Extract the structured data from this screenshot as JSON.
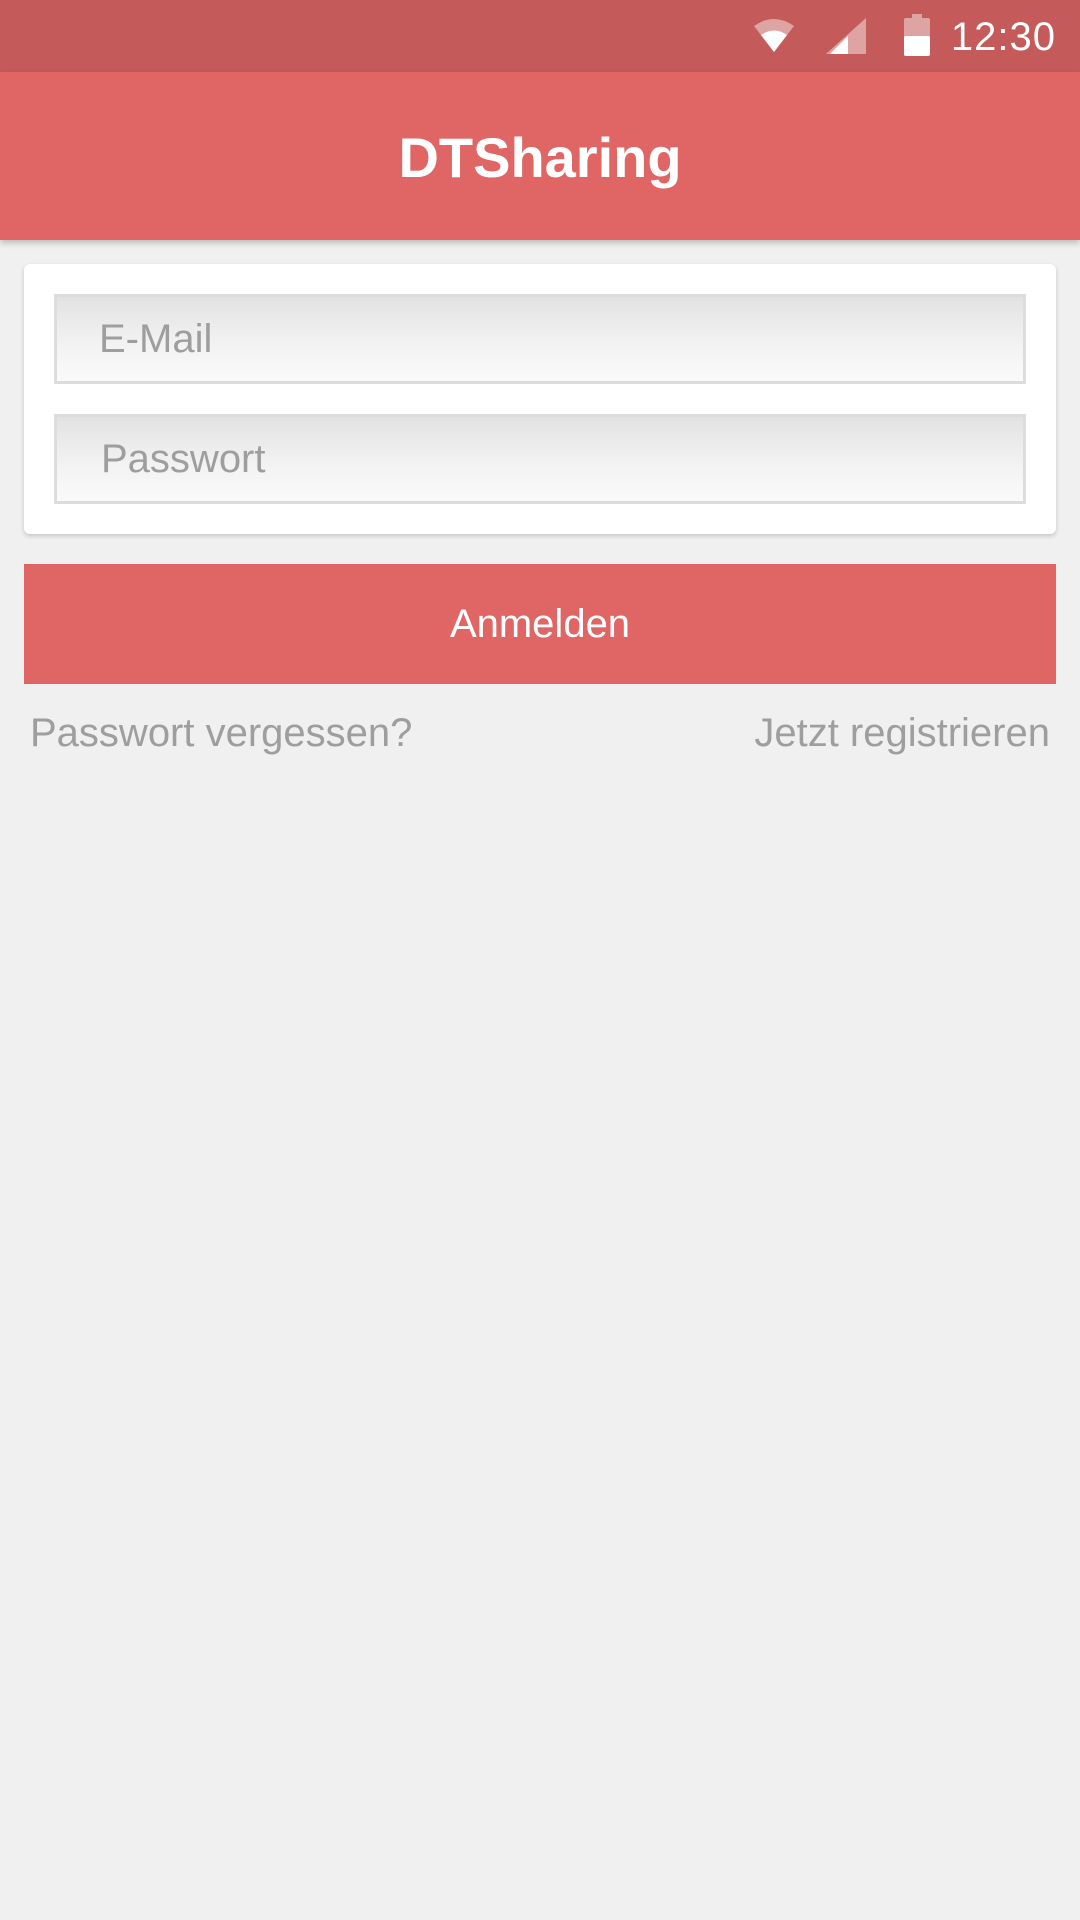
{
  "status_bar": {
    "time": "12:30",
    "icons": [
      "wifi-icon",
      "cell-signal-icon",
      "battery-icon"
    ],
    "color": "#c45a5a"
  },
  "app_bar": {
    "title": "DTSharing",
    "color": "#e06666"
  },
  "login_form": {
    "email_placeholder": "E-Mail",
    "password_placeholder": "Passwort"
  },
  "login_button": {
    "label": "Anmelden"
  },
  "links": {
    "forgot_password": "Passwort vergessen?",
    "register": "Jetzt registrieren"
  },
  "colors": {
    "accent": "#e06666",
    "background": "#f0f0f0",
    "muted_text": "#9e9e9e"
  }
}
